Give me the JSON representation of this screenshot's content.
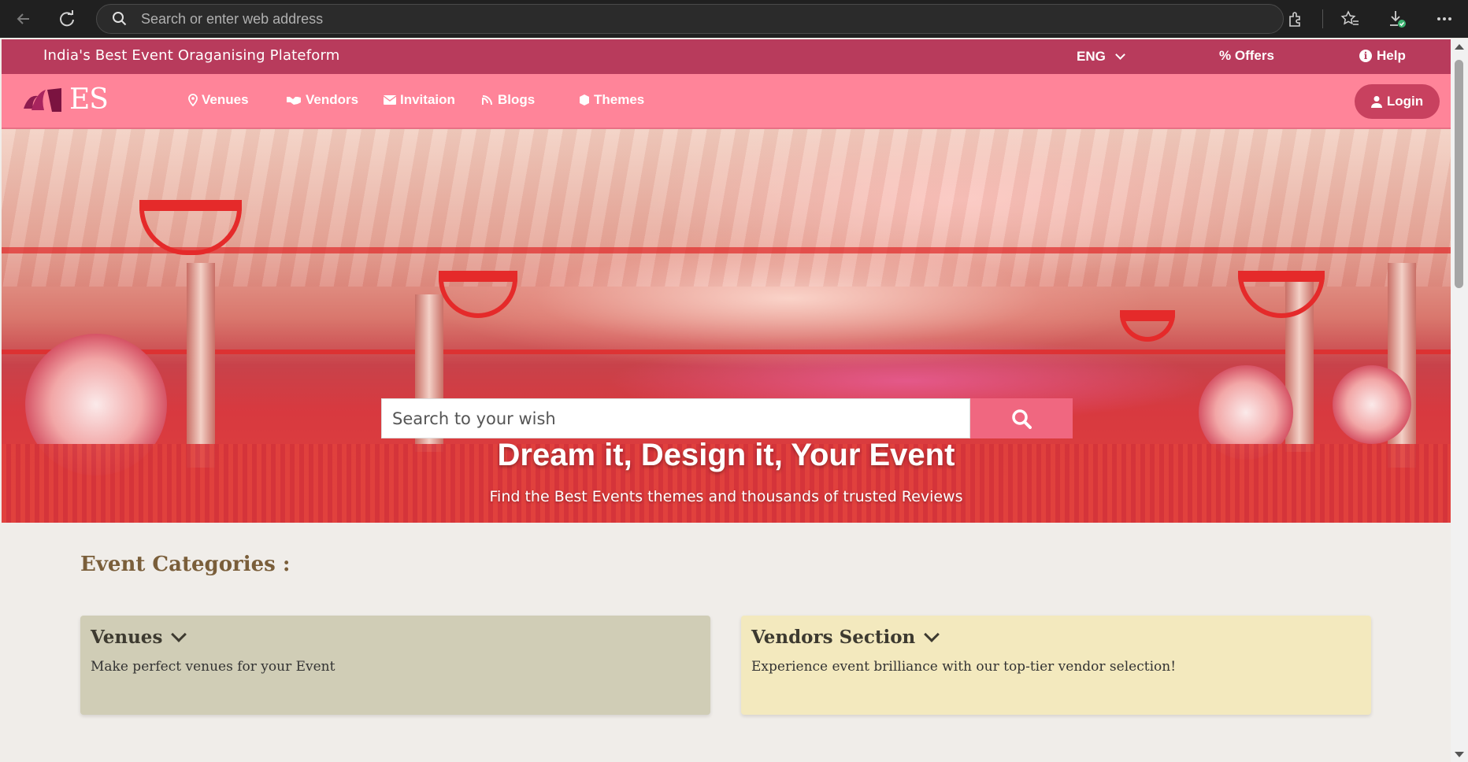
{
  "browser": {
    "address_placeholder": "Search or enter web address",
    "icons": [
      "back-icon",
      "reload-icon",
      "search-icon",
      "extensions-icon",
      "favorites-icon",
      "downloads-icon",
      "more-icon"
    ]
  },
  "top_strip": {
    "tagline": "India's Best Event Oraganising Plateform",
    "language": "ENG",
    "offers_label": "Offers",
    "help_label": "Help"
  },
  "navbar": {
    "logo_text": "ES",
    "items": [
      {
        "label": "Venues",
        "icon": "map-pin-icon"
      },
      {
        "label": "Vendors",
        "icon": "handshake-icon"
      },
      {
        "label": "Invitaion",
        "icon": "envelope-icon"
      },
      {
        "label": "Blogs",
        "icon": "blog-icon"
      },
      {
        "label": "Themes",
        "icon": "cube-icon"
      }
    ],
    "login_label": "Login"
  },
  "hero": {
    "search_placeholder": "Search to your wish",
    "title": "Dream it, Design it, Your Event",
    "subtitle": "Find the Best Events themes and thousands of trusted Reviews"
  },
  "categories": {
    "heading": "Event Categories :",
    "cards": [
      {
        "title": "Venues",
        "description": "Make perfect venues for your Event",
        "color": "#d0cdb6"
      },
      {
        "title": "Vendors Section",
        "description": "Experience event brilliance with our top-tier vendor selection!",
        "color": "#f3e9be"
      }
    ]
  },
  "colors": {
    "top_strip": "#b83b5c",
    "navbar": "#ff8499",
    "login_button": "#c8415f",
    "search_button": "#f06780",
    "heading": "#7a5e3a"
  }
}
